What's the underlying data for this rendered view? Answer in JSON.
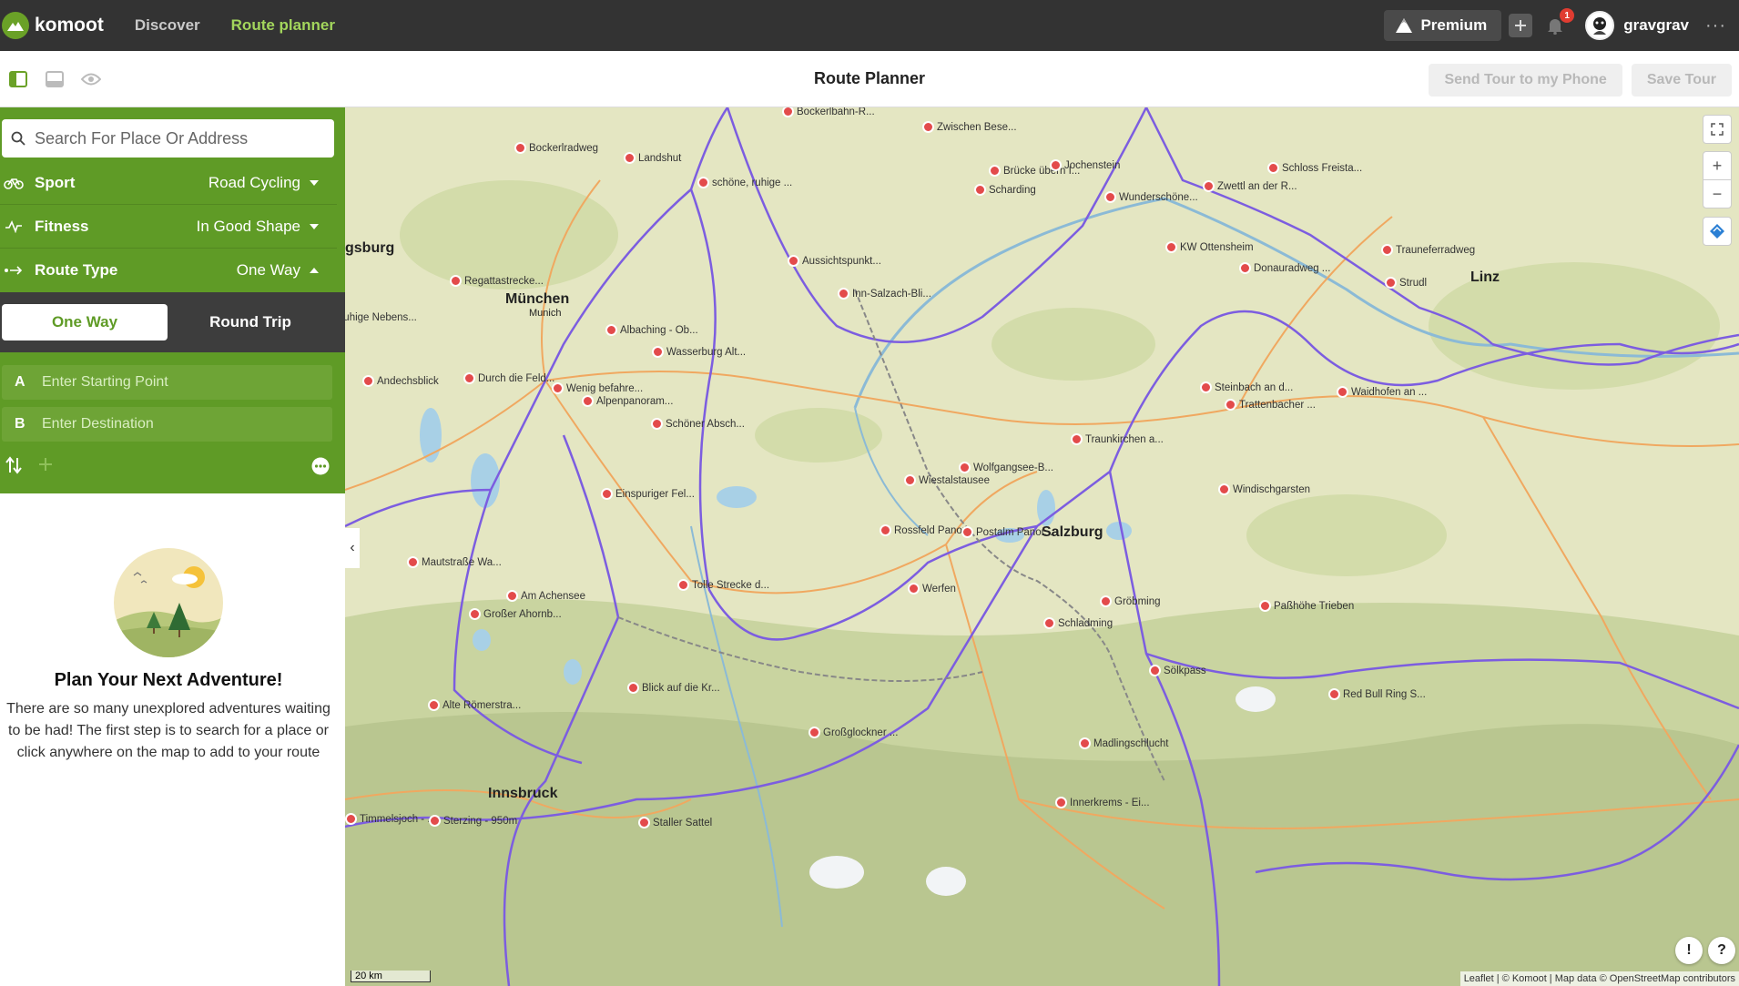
{
  "app": {
    "logo_text": "komoot"
  },
  "nav": {
    "discover": "Discover",
    "route_planner": "Route planner"
  },
  "topbar": {
    "premium_label": "Premium",
    "notification_count": "1",
    "username": "gravgrav",
    "more": "···"
  },
  "subbar": {
    "title": "Route Planner",
    "send_label": "Send Tour to my Phone",
    "save_label": "Save Tour"
  },
  "planner": {
    "search_placeholder": "Search For Place Or Address",
    "sport": {
      "label": "Sport",
      "value": "Road Cycling"
    },
    "fitness": {
      "label": "Fitness",
      "value": "In Good Shape"
    },
    "route_type": {
      "label": "Route Type",
      "value": "One Way"
    },
    "toggle": {
      "one_way": "One Way",
      "round_trip": "Round Trip"
    },
    "start": {
      "letter": "A",
      "placeholder": "Enter Starting Point"
    },
    "destination": {
      "letter": "B",
      "placeholder": "Enter Destination"
    }
  },
  "empty_state": {
    "title": "Plan Your Next Adventure!",
    "text": "There are so many unexplored adventures waiting to be had! The first step is to search for a place or click anywhere on the map to add to your route"
  },
  "map": {
    "cities": [
      "München",
      "Munich",
      "Salzburg",
      "Innsbruck",
      "Linz",
      "gsburg"
    ],
    "pois": [
      "Bockerlbahn-R...",
      "Bockerlradweg",
      "Landshut",
      "schöne, ruhige ...",
      "Zwischen Bese...",
      "Brücke übern I...",
      "Scharding",
      "Jochenstein",
      "Wunderschöne...",
      "Schloss Freista...",
      "Zwettl an der R...",
      "KW Ottensheim",
      "Donauradweg ...",
      "Trauneferradweg",
      "Aussichtspunkt...",
      "Inn-Salzach-Bli...",
      "Regattastrecke...",
      "Ruhige Nebens...",
      "Albaching - Ob...",
      "Wasserburg Alt...",
      "Andechsblick",
      "Durch die Feld...",
      "Wenig befahre...",
      "Alpenpanoram...",
      "Schöner Absch...",
      "Einspuriger Fel...",
      "Wolfgangsee-B...",
      "Wiestalstausee",
      "Steinbach an d...",
      "Trattenbacher ...",
      "Waidhofen an ...",
      "Traunkirchen a...",
      "Windischgarsten",
      "Rossfeld Panor...",
      "Postalm Panor...",
      "Mautstraße Wa...",
      "Am Achensee",
      "Großer Ahornb...",
      "Tolle Strecke d...",
      "Werfen",
      "Gröbming",
      "Paßhöhe Trieben",
      "Schladming",
      "Sölkpass",
      "Red Bull Ring S...",
      "Alte Römerstra...",
      "Blick auf die Kr...",
      "Großglockner ...",
      "Madlingschlucht",
      "Innerkrems - Ei...",
      "Timmelsjoch - ...",
      "Sterzing - 950m",
      "Staller Sattel",
      "Strudl"
    ],
    "scale": "20 km",
    "attribution": "Leaflet | © Komoot | Map data © OpenStreetMap contributors"
  }
}
